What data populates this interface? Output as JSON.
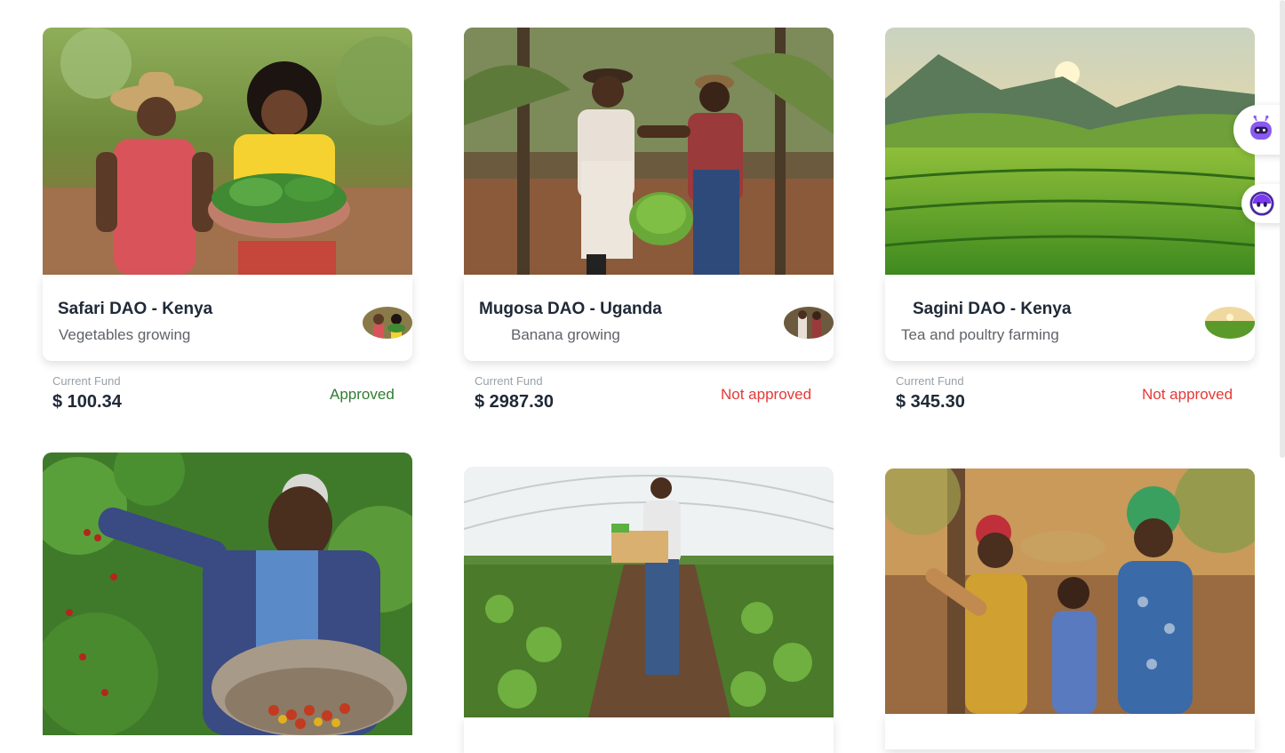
{
  "projects": [
    {
      "name": "Safari DAO - Kenya",
      "activity": "Vegetables growing",
      "fund_label": "Current Fund",
      "fund": "$ 100.34",
      "status": "Approved"
    },
    {
      "name": "Mugosa DAO - Uganda",
      "activity": "Banana growing",
      "fund_label": "Current Fund",
      "fund": "$ 2987.30",
      "status": "Not approved"
    },
    {
      "name": "Sagini DAO - Kenya",
      "activity": "Tea and poultry farming",
      "fund_label": "Current Fund",
      "fund": "$ 345.30",
      "status": "Not approved"
    }
  ],
  "colors": {
    "approved": "#2e7d32",
    "not_approved": "#e53935",
    "title": "#1f2937"
  },
  "icons": {
    "assistant_button": "robot-icon",
    "chat_button": "chat-bot-icon"
  }
}
